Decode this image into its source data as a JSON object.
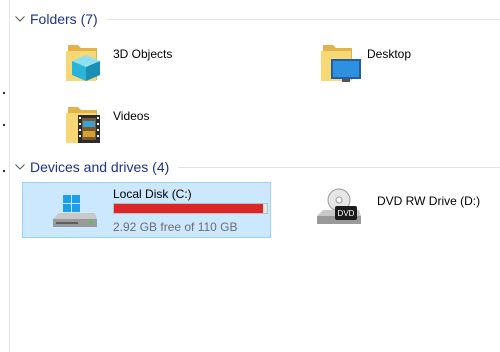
{
  "folders_group": {
    "title": "Folders (7)",
    "items": [
      {
        "label": "3D Objects",
        "icon": "3d-objects-folder-icon"
      },
      {
        "label": "Desktop",
        "icon": "desktop-folder-icon"
      },
      {
        "label": "Videos",
        "icon": "videos-folder-icon"
      }
    ]
  },
  "devices_group": {
    "title": "Devices and drives (4)",
    "drives": [
      {
        "name": "Local Disk (C:)",
        "free_text": "2.92 GB free of 110 GB",
        "used_fraction": 0.973,
        "selected": true,
        "icon": "windows-drive-icon"
      },
      {
        "name": "DVD RW Drive (D:)",
        "icon": "dvd-drive-icon",
        "icon_text": "DVD"
      }
    ]
  },
  "colors": {
    "group_title": "#1e3287",
    "selection_bg": "#cce8ff",
    "selection_border": "#99d1ff",
    "usage_bar_fill": "#da2626",
    "folder_yellow": "#f8d775"
  }
}
